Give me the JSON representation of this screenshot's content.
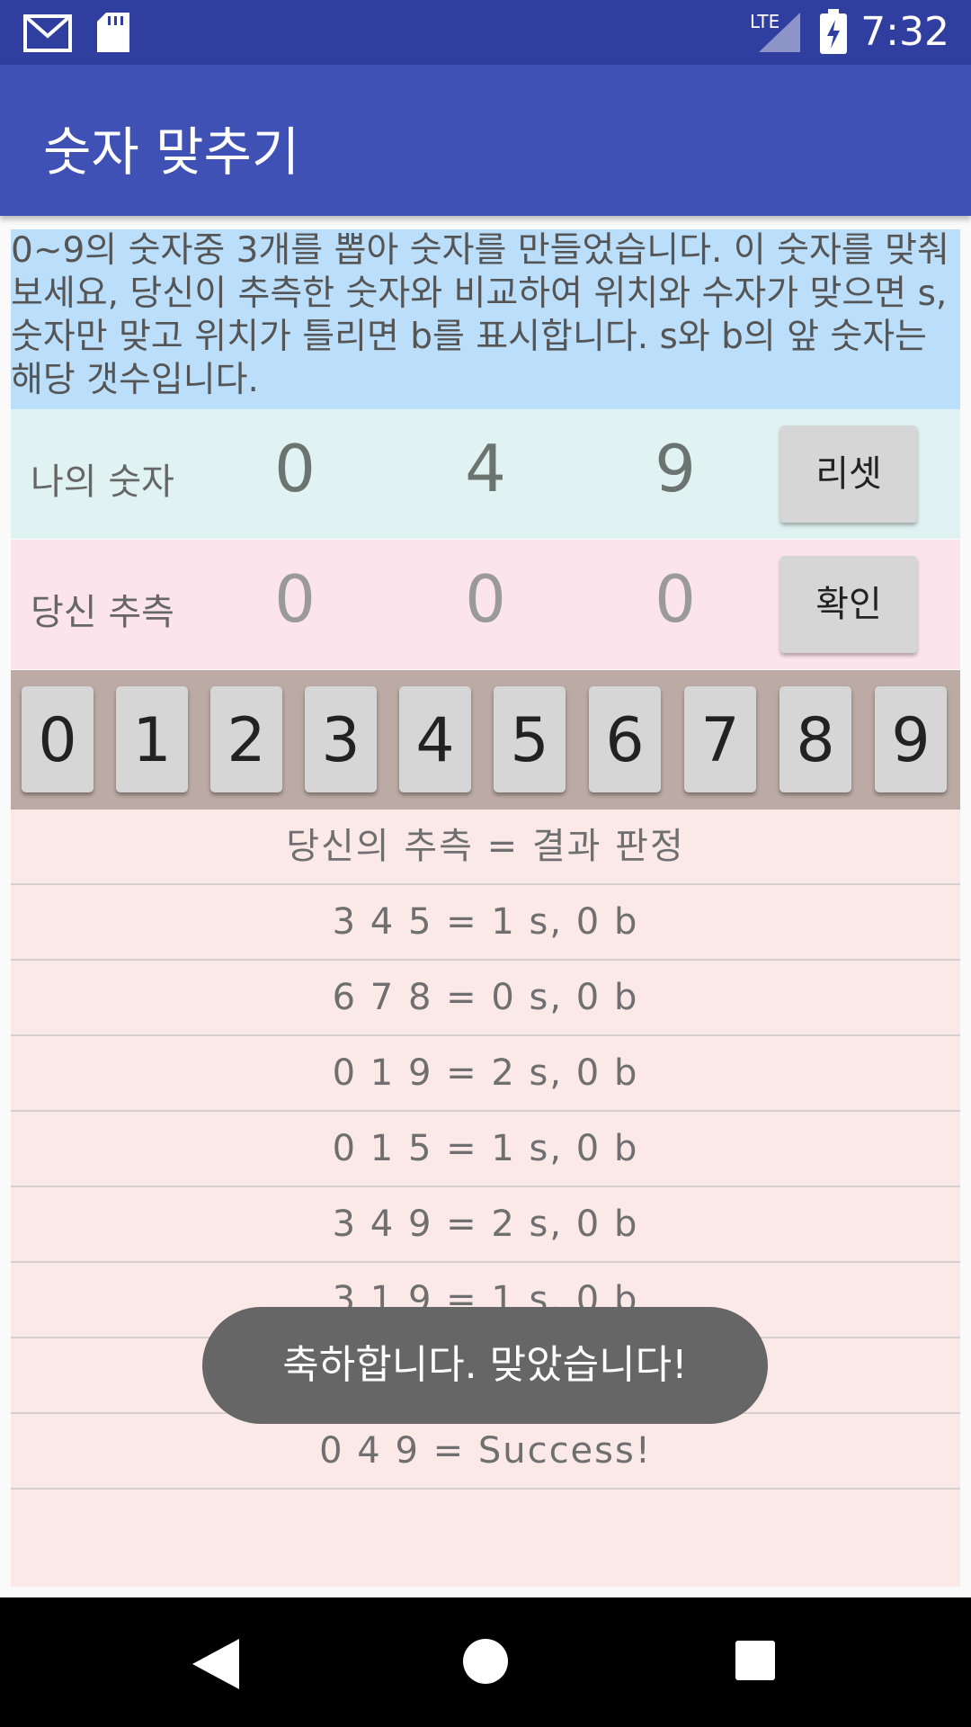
{
  "status_bar": {
    "time": "7:32",
    "network_label": "LTE",
    "icons": [
      "gmail-icon",
      "sd-card-icon",
      "lte-signal-icon",
      "battery-charging-icon"
    ]
  },
  "app_bar": {
    "title": "숫자 맞추기"
  },
  "instructions": "0~9의 숫자중 3개를 뽑아 숫자를 만들었습니다. 이 숫자를 맞춰 보세요, 당신이 추측한 숫자와 비교하여 위치와 수자가 맞으면 s, 숫자만 맞고 위치가 틀리면 b를 표시합니다. s와 b의 앞 숫자는 해당 갯수입니다.",
  "my_number": {
    "label": "나의 숫자",
    "digits": [
      "0",
      "4",
      "9"
    ],
    "reset_label": "리셋"
  },
  "guess": {
    "label": "당신 추측",
    "digits": [
      "0",
      "0",
      "0"
    ],
    "confirm_label": "확인"
  },
  "keypad": [
    "0",
    "1",
    "2",
    "3",
    "4",
    "5",
    "6",
    "7",
    "8",
    "9"
  ],
  "history": {
    "header": "당신의 추측  =  결과 판정",
    "rows": [
      "3 4 5  =  1 s, 0 b",
      "6 7 8  =  0 s, 0 b",
      "0 1 9  =  2 s, 0 b",
      "0 1 5  =  1 s, 0 b",
      "3 4 9  =  2 s, 0 b",
      "3 1 9  =  1 s, 0 b",
      "0 4 9  =  Success!"
    ]
  },
  "toast": "축하합니다. 맞았습니다!",
  "colors": {
    "status_bar": "#303f9f",
    "app_bar": "#3f51b5",
    "instructions_bg": "#bbdefb",
    "my_row_bg": "#e0f2f1",
    "guess_row_bg": "#fce4ec",
    "keypad_bg": "#bcaaa4",
    "history_bg": "#fbe9e7"
  }
}
